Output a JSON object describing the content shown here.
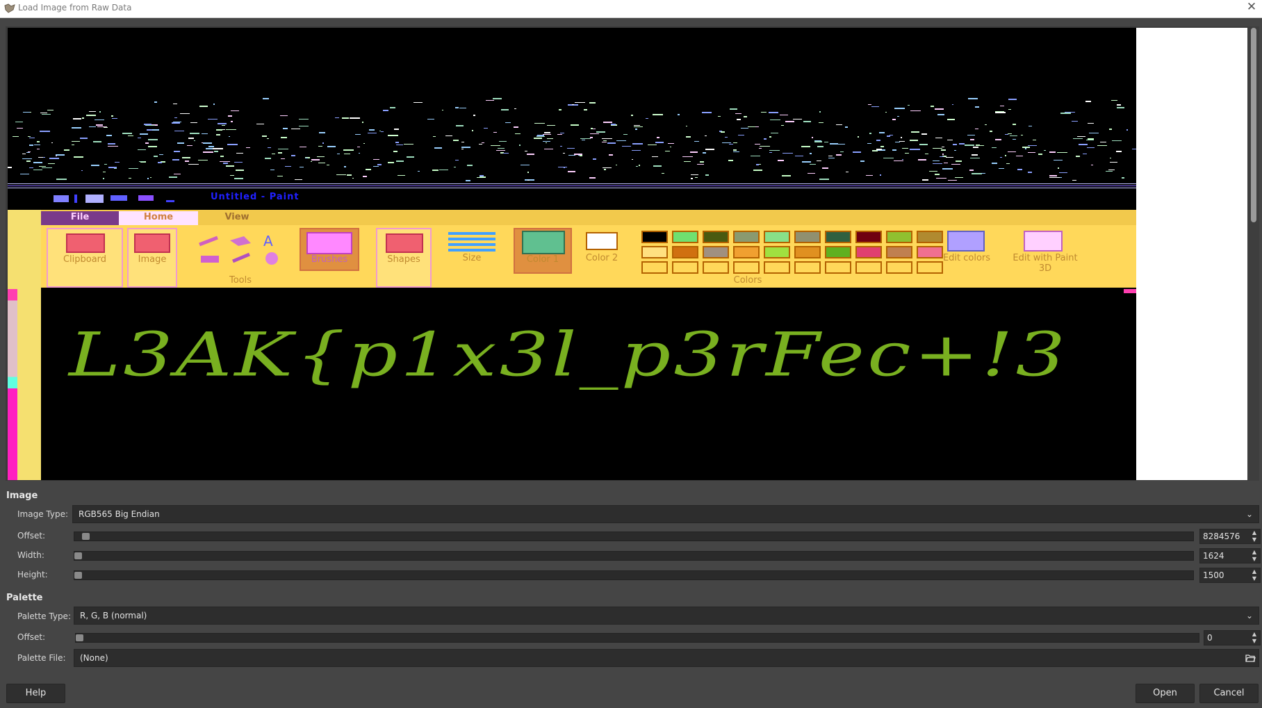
{
  "window": {
    "title": "Load Image from Raw Data"
  },
  "preview": {
    "paint_title": "Untitled - Paint",
    "tabs": [
      "File",
      "Home",
      "View"
    ],
    "groups": {
      "clipboard": "Clipboard",
      "image": "Image",
      "tools": "Tools",
      "brushes": "Brushes",
      "shapes": "Shapes",
      "size": "Size",
      "color1": "Color 1",
      "color2": "Color 2",
      "colors": "Colors",
      "edit_colors": "Edit colors",
      "edit_paint3d": "Edit with Paint 3D"
    },
    "canvas_text": "L3AK{p1x3l_p3rFec+!3",
    "colors": {
      "ribbon": "#ffd85a",
      "text": "#79b020",
      "accent": "#f19ad0"
    }
  },
  "image_section": {
    "title": "Image",
    "image_type_label": "Image Type:",
    "image_type_value": "RGB565 Big Endian",
    "offset_label": "Offset:",
    "offset_value": "8284576",
    "width_label": "Width:",
    "width_value": "1624",
    "height_label": "Height:",
    "height_value": "1500"
  },
  "palette_section": {
    "title": "Palette",
    "palette_type_label": "Palette Type:",
    "palette_type_value": "R, G, B (normal)",
    "offset_label": "Offset:",
    "offset_value": "0",
    "palette_file_label": "Palette File:",
    "palette_file_value": "(None)"
  },
  "buttons": {
    "help": "Help",
    "open": "Open",
    "cancel": "Cancel"
  }
}
